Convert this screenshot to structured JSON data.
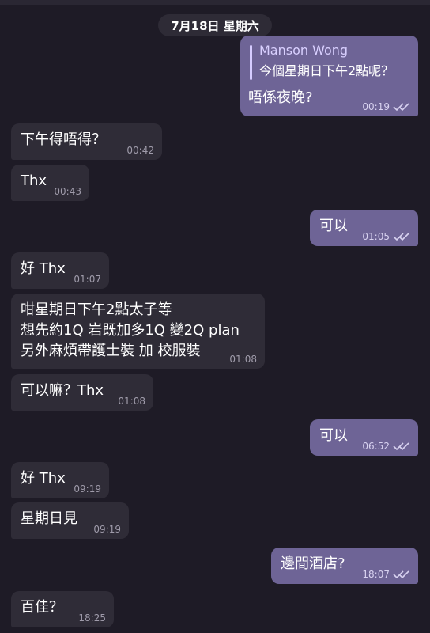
{
  "date_divider": "7月18日 星期六",
  "messages": [
    {
      "dir": "out",
      "reply_name": "Manson Wong",
      "reply_text": "今個星期日下午2點呢？",
      "text": "唔係夜晚?",
      "time": "00:19"
    },
    {
      "dir": "in",
      "text": "下午得唔得？",
      "time": "00:42"
    },
    {
      "dir": "in",
      "text": "Thx",
      "time": "00:43"
    },
    {
      "dir": "out",
      "text": "可以",
      "time": "01:05"
    },
    {
      "dir": "in",
      "text": "好 Thx",
      "time": "01:07"
    },
    {
      "dir": "in",
      "lines": [
        "咁星期日下午2點太子等",
        "想先約1Q 岩既加多1Q 變2Q plan",
        "另外麻煩帶護士裝 加 校服裝"
      ],
      "time": "01:08"
    },
    {
      "dir": "in",
      "text": "可以嘛？Thx",
      "time": "01:08"
    },
    {
      "dir": "out",
      "text": "可以",
      "time": "06:52"
    },
    {
      "dir": "in",
      "text": "好 Thx",
      "time": "09:19"
    },
    {
      "dir": "in",
      "text": "星期日見",
      "time": "09:19"
    },
    {
      "dir": "out",
      "text": "邊間酒店?",
      "time": "18:07"
    },
    {
      "dir": "in",
      "text": "百佳？",
      "time": "18:25"
    }
  ],
  "colors": {
    "background": "#1e1b26",
    "incoming": "#2f2c37",
    "outgoing": "#6e6496",
    "reply_name": "#d9d0ff"
  },
  "icons": {
    "read_receipt": "double-check-icon"
  }
}
